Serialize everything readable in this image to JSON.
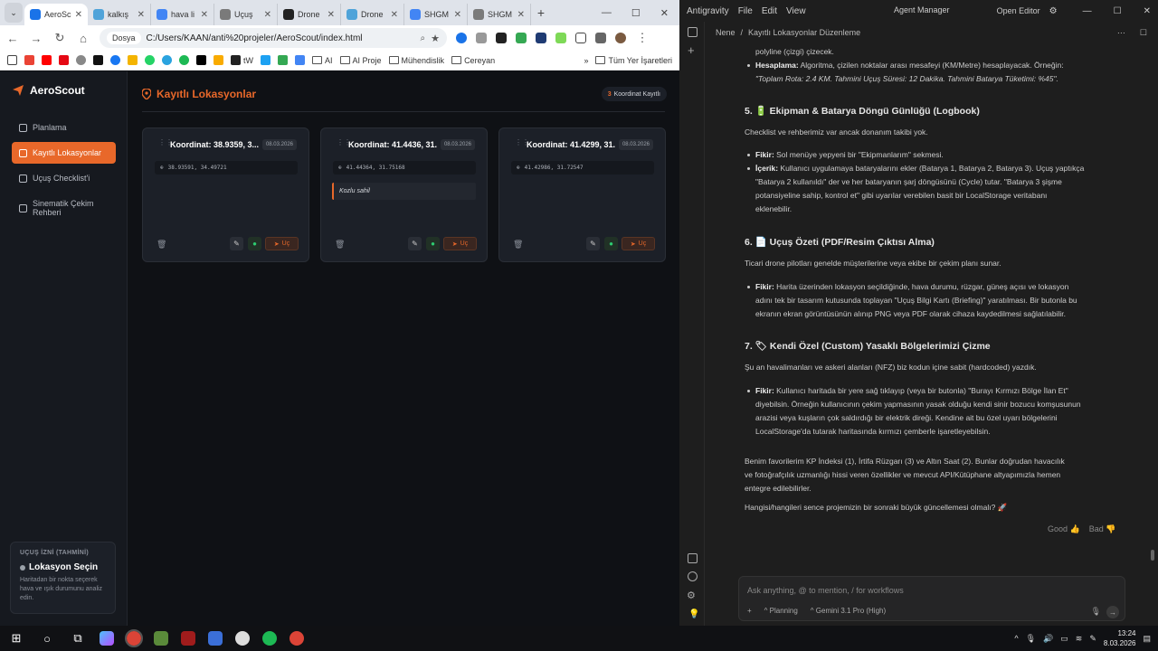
{
  "browser": {
    "tabs": [
      {
        "label": "AeroSc",
        "active": true,
        "color": "#1a73e8"
      },
      {
        "label": "kalkış",
        "active": false,
        "color": "#4fa3d9"
      },
      {
        "label": "hava li",
        "active": false,
        "color": "#4285f4"
      },
      {
        "label": "Uçuş",
        "active": false,
        "color": "#7a7a7a"
      },
      {
        "label": "Drone",
        "active": false,
        "color": "#222222"
      },
      {
        "label": "Drone",
        "active": false,
        "color": "#4fa3d9"
      },
      {
        "label": "SHGM",
        "active": false,
        "color": "#4285f4"
      },
      {
        "label": "SHGM",
        "active": false,
        "color": "#7a7a7a"
      }
    ],
    "new_tab": "+",
    "chip": "Dosya",
    "url": "C:/Users/KAAN/anti%20projeler/AeroScout/index.html",
    "bookmarks": {
      "folders": [
        "AI",
        "AI Proje",
        "Mühendislik",
        "Cereyan"
      ],
      "tw": "tW",
      "all": "Tüm Yer İşaretleri"
    }
  },
  "app": {
    "brand": "AeroScout",
    "nav": [
      {
        "label": "Planlama"
      },
      {
        "label": "Kayıtlı Lokasyonlar"
      },
      {
        "label": "Uçuş Checklist'i"
      },
      {
        "label": "Sinematik Çekim Rehberi"
      }
    ],
    "flight_card": {
      "label": "UÇUŞ İZNİ (TAHMİNİ)",
      "title": "Lokasyon Seçin",
      "desc": "Haritadan bir nokta seçerek hava ve ışık durumunu analiz edin."
    },
    "page_title": "Kayıtlı Lokasyonlar",
    "count": "3",
    "count_label": "Koordinat Kayıtlı",
    "cards": [
      {
        "title": "Koordinat: 38.9359, 3...",
        "date": "08.03.2026",
        "coords": "38.93591, 34.49721",
        "note": "",
        "fly": "Uç"
      },
      {
        "title": "Koordinat: 41.4436, 31...",
        "date": "08.03.2026",
        "coords": "41.44364, 31.75168",
        "note": "Kozlu sahil",
        "fly": "Uç"
      },
      {
        "title": "Koordinat: 41.4299, 31...",
        "date": "08.03.2026",
        "coords": "41.42986, 31.72547",
        "note": "",
        "fly": "Uç"
      }
    ]
  },
  "ide": {
    "menu": [
      "Antigravity",
      "File",
      "Edit",
      "View"
    ],
    "agent_manager": "Agent Manager",
    "open_editor": "Open Editor",
    "breadcrumb_root": "Nene",
    "breadcrumb_title": "Kayıtlı Lokasyonlar Düzenleme",
    "chat": {
      "l1": "polyline (çizgi) çizecek.",
      "l2b": "Hesaplama:",
      "l2": " Algoritma, çizilen noktalar arası mesafeyi (KM/Metre) hesaplayacak. Örneğin:",
      "l3": "\"Toplam Rota: 2.4 KM. Tahmini Uçuş Süresi: 12 Dakika. Tahmini Batarya Tüketimi: %45\".",
      "h5": "5. 🔋 Ekipman & Batarya Döngü Günlüğü (Logbook)",
      "p5": "Checklist ve rehberimiz var ancak donanım takibi yok.",
      "f5b": "Fikir:",
      "f5": " Sol menüye yepyeni bir \"Ekipmanlarım\" sekmesi.",
      "i5b": "İçerik:",
      "i5a": " Kullanıcı uygulamaya bataryalarını ekler (Batarya 1, Batarya 2, Batarya 3). Uçuş yaptıkça",
      "i5c": "\"Batarya 2 kullanıldı\" der ve her bataryanın şarj döngüsünü (Cycle) tutar. \"Batarya 3 şişme",
      "i5d": "potansiyeline sahip, kontrol et\" gibi uyarılar verebilen basit bir LocalStorage veritabanı",
      "i5e": "eklenebilir.",
      "h6": "6. 📄 Uçuş Özeti (PDF/Resim Çıktısı Alma)",
      "p6": "Ticari drone pilotları genelde müşterilerine veya ekibe bir çekim planı sunar.",
      "f6b": "Fikir:",
      "f6a": " Harita üzerinden lokasyon seçildiğinde, hava durumu, rüzgar, güneş açısı ve lokasyon",
      "f6c": "adını tek bir tasarım kutusunda toplayan \"Uçuş Bilgi Kartı (Briefing)\" yaratılması. Bir butonla bu",
      "f6d": "ekranın ekran görüntüsünün alınıp PNG veya PDF olarak cihaza kaydedilmesi sağlatılabilir.",
      "h7": "7. 🏷 Kendi Özel (Custom) Yasaklı Bölgelerimizi Çizme",
      "p7": "Şu an havalimanları ve askeri alanları (NFZ) biz kodun içine sabit (hardcoded) yazdık.",
      "f7b": "Fikir:",
      "f7a": " Kullanıcı haritada bir yere sağ tıklayıp (veya bir butonla) \"Burayı Kırmızı Bölge İlan Et\"",
      "f7c": "diyebilsin. Örneğin kullanıcının çekim yapmasının yasak olduğu kendi sinir bozucu komşusunun",
      "f7d": "arazisi veya kuşların çok saldırdığı bir elektrik direği. Kendine ait bu özel uyarı bölgelerini",
      "f7e": "LocalStorage'da tutarak haritasında kırmızı çemberle işaretleyebilsin.",
      "fav1": "Benim favorilerim KP İndeksi (1), İrtifa Rüzgarı (3) ve Altın Saat (2). Bunlar doğrudan havacılık",
      "fav2": "ve fotoğrafçılık uzmanlığı hissi veren özellikler ve mevcut API/Kütüphane altyapımızla hemen",
      "fav3": "entegre edilebilirler.",
      "q": "Hangisi/hangileri sence projemizin bir sonraki büyük güncellemesi olmalı? 🚀"
    },
    "feedback_good": "Good",
    "feedback_bad": "Bad",
    "input_placeholder": "Ask anything, @ to mention, / for workflows",
    "mode": "Planning",
    "model": "Gemini 3.1 Pro (High)"
  },
  "taskbar": {
    "time": "13:24",
    "date": "8.03.2026"
  }
}
